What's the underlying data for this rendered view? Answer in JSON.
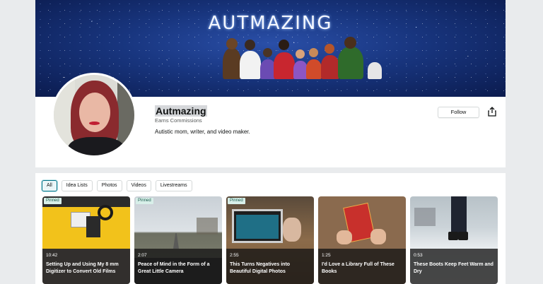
{
  "banner": {
    "title": "AUTMAZING"
  },
  "profile": {
    "name": "Autmazing",
    "earns": "Earns Commissions",
    "bio": "Autistic mom, writer, and video maker.",
    "follow_label": "Follow",
    "share_icon": "share-icon"
  },
  "tabs": [
    {
      "label": "All",
      "active": true
    },
    {
      "label": "Idea Lists",
      "active": false
    },
    {
      "label": "Photos",
      "active": false
    },
    {
      "label": "Videos",
      "active": false
    },
    {
      "label": "Livestreams",
      "active": false
    }
  ],
  "videos": [
    {
      "pinned": "Pinned",
      "duration": "10:42",
      "title": "Setting Up and Using My 8 mm Digitizer to Convert Old Films"
    },
    {
      "pinned": "Pinned",
      "duration": "2:07",
      "title": "Peace of Mind in the Form of a Great Little Camera"
    },
    {
      "pinned": "Pinned",
      "duration": "2:55",
      "title": "This Turns Negatives into Beautiful Digital Photos"
    },
    {
      "pinned": "",
      "duration": "1:25",
      "title": "I'd Love a Library Full of These Books"
    },
    {
      "pinned": "",
      "duration": "0:53",
      "title": "These Boots Keep Feet Warm and Dry"
    }
  ],
  "colors": {
    "accent": "#007185",
    "banner": "#18357e"
  }
}
